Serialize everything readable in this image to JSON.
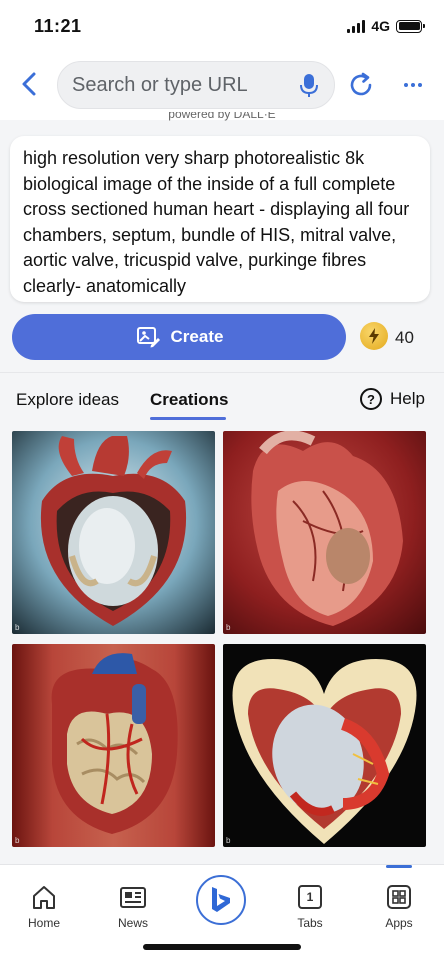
{
  "status_bar": {
    "time": "11:21",
    "network": "4G"
  },
  "browser": {
    "search_placeholder": "Search or type URL"
  },
  "powered_by": "powered by DALL·E",
  "prompt": {
    "text": "high resolution very sharp photorealistic 8k biological image of the inside of a full complete cross sectioned human heart - displaying all four chambers, septum, bundle of HIS, mitral valve, aortic valve, tricuspid valve, purkinge fibres clearly- anatomically"
  },
  "create": {
    "label": "Create",
    "boosts": "40"
  },
  "tabs": {
    "explore": "Explore ideas",
    "creations": "Creations",
    "help": "Help"
  },
  "bottom_nav": {
    "home": "Home",
    "news": "News",
    "tabs": "Tabs",
    "tabs_count": "1",
    "apps": "Apps"
  },
  "icons": {
    "back": "chevron-left-icon",
    "mic": "microphone-icon",
    "refresh": "refresh-icon",
    "more": "more-icon",
    "create": "image-create-icon",
    "boost": "lightning-icon",
    "help": "question-circle-icon",
    "home": "home-icon",
    "news": "news-icon",
    "bing": "bing-logo-icon",
    "tabs": "tabs-icon",
    "apps": "apps-grid-icon"
  },
  "colors": {
    "accent": "#4f6ed9",
    "link_blue": "#3b6fd8"
  }
}
